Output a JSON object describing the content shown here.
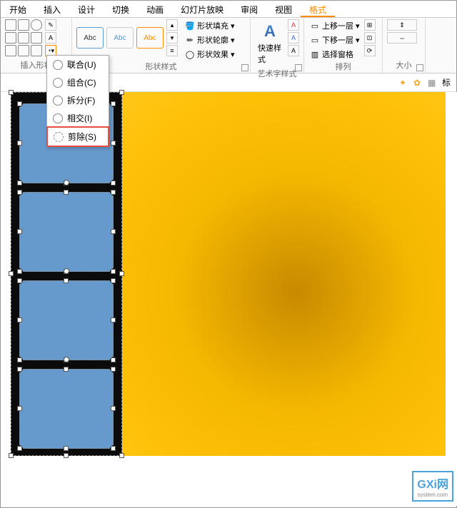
{
  "tabs": [
    "开始",
    "插入",
    "设计",
    "切换",
    "动画",
    "幻灯片放映",
    "审阅",
    "视图",
    "格式"
  ],
  "active_tab_index": 8,
  "ribbon": {
    "groups": {
      "insert_shape": "插入形状",
      "shape_style": "形状样式",
      "wordart_style": "艺术字样式",
      "arrange": "排列",
      "size": "大小"
    },
    "style_label": "Abc",
    "shape_fill": "形状填充",
    "shape_outline": "形状轮廓",
    "shape_effects": "形状效果",
    "quick_style": "快速样式",
    "bring_forward": "上移一层",
    "send_backward": "下移一层",
    "selection_pane": "选择窗格"
  },
  "merge_menu": {
    "items": [
      {
        "label": "联合(U)"
      },
      {
        "label": "组合(C)"
      },
      {
        "label": "拆分(F)"
      },
      {
        "label": "相交(I)"
      },
      {
        "label": "剪除(S)"
      }
    ],
    "highlighted_index": 4
  },
  "toolbar2": {
    "label": "标"
  },
  "watermark": {
    "main": "GXi网",
    "sub": "system.com"
  }
}
